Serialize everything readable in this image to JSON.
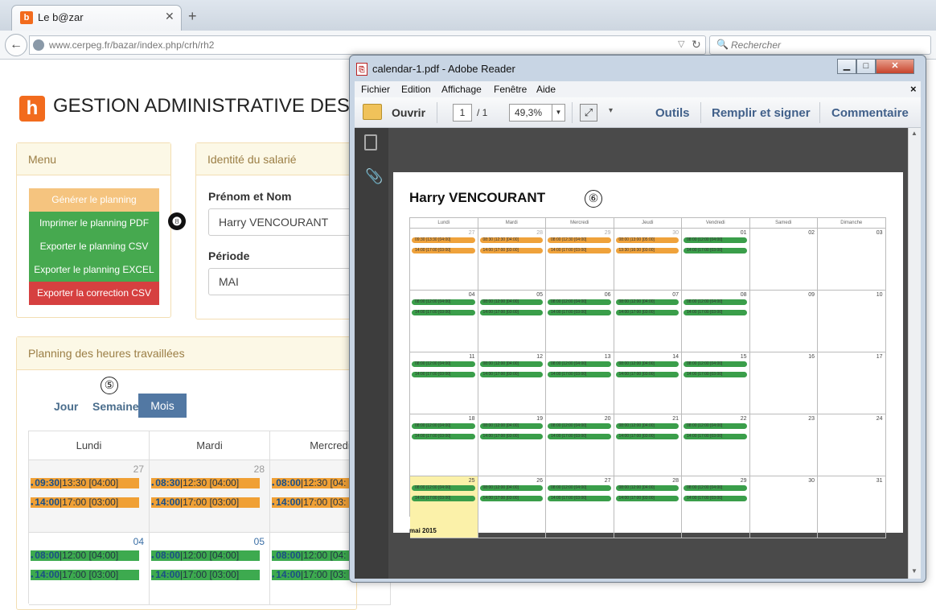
{
  "browser": {
    "tab_title": "Le b@zar",
    "favicon": "b",
    "new_tab": "+",
    "url": "www.cerpeg.fr/bazar/index.php/crh/rh2",
    "search_placeholder": "Rechercher"
  },
  "app": {
    "logo": "h",
    "title": "GESTION ADMINISTRATIVE DES"
  },
  "menu": {
    "title": "Menu",
    "buttons": [
      {
        "label": "Générer le planning",
        "color": "#f5c47f"
      },
      {
        "label": "Imprimer le planning PDF",
        "color": "#46a94f"
      },
      {
        "label": "Exporter le planning CSV",
        "color": "#46a94f"
      },
      {
        "label": "Exporter le planning EXCEL",
        "color": "#46a94f"
      },
      {
        "label": "Exporter la correction CSV",
        "color": "#d64040"
      }
    ]
  },
  "annotation_8": "❽",
  "identity": {
    "title": "Identité du salarié",
    "name_label": "Prénom et Nom",
    "name_value": "Harry VENCOURANT",
    "period_label": "Période",
    "period_value": "MAI"
  },
  "planning": {
    "title": "Planning des heures travaillées",
    "annotation_5": "⑤",
    "views": {
      "day": "Jour",
      "week": "Semaine",
      "month": "Mois"
    },
    "headers": [
      "Lundi",
      "Mardi",
      "Mercredi"
    ],
    "rows": [
      [
        {
          "day": "27",
          "events": [
            {
              "start": "09:30",
              "rest": "|13:30 [04:00]",
              "color": "orange"
            },
            {
              "start": "14:00",
              "rest": "|17:00 [03:00]",
              "color": "orange"
            }
          ]
        },
        {
          "day": "28",
          "events": [
            {
              "start": "08:30",
              "rest": "|12:30 [04:00]",
              "color": "orange"
            },
            {
              "start": "14:00",
              "rest": "|17:00 [03:00]",
              "color": "orange"
            }
          ]
        },
        {
          "day": "",
          "events": [
            {
              "start": "08:00",
              "rest": "|12:30 [04:",
              "color": "orange"
            },
            {
              "start": "14:00",
              "rest": "|17:00 [03:",
              "color": "orange"
            }
          ]
        }
      ],
      [
        {
          "day": "04",
          "events": [
            {
              "start": "08:00",
              "rest": "|12:00 [04:00]",
              "color": "green"
            },
            {
              "start": "14:00",
              "rest": "|17:00 [03:00]",
              "color": "green"
            }
          ]
        },
        {
          "day": "05",
          "events": [
            {
              "start": "08:00",
              "rest": "|12:00 [04:00]",
              "color": "green"
            },
            {
              "start": "14:00",
              "rest": "|17:00 [03:00]",
              "color": "green"
            }
          ]
        },
        {
          "day": "",
          "events": [
            {
              "start": "08:00",
              "rest": "|12:00 [04:",
              "color": "green"
            },
            {
              "start": "14:00",
              "rest": "|17:00 [03:",
              "color": "green"
            }
          ]
        }
      ]
    ]
  },
  "pdf_window": {
    "title": "calendar-1.pdf - Adobe Reader",
    "menu": [
      "Fichier",
      "Edition",
      "Affichage",
      "Fenêtre",
      "Aide"
    ],
    "close_doc": "×",
    "open_label": "Ouvrir",
    "page_current": "1",
    "page_total": "/ 1",
    "zoom": "49,3%",
    "tools": "Outils",
    "fill_sign": "Remplir et signer",
    "comment": "Commentaire",
    "document": {
      "name": "Harry VENCOURANT",
      "annotation_6": "⑥",
      "footer": "mai 2015",
      "day_headers": [
        "Lundi",
        "Mardi",
        "Mercredi",
        "Jeudi",
        "Vendredi",
        "Samedi",
        "Dimanche"
      ],
      "weeks": [
        {
          "days": [
            "27",
            "28",
            "29",
            "30",
            "01",
            "02",
            "03"
          ],
          "events": [
            [
              {
                "t": "09:30 |13:30 [04:00]",
                "c": "or"
              },
              {
                "t": "14:00 |17:00 [03:00]",
                "c": "or"
              }
            ],
            [
              {
                "t": "08:30 |12:30 [04:00]",
                "c": "or"
              },
              {
                "t": "14:00 |17:00 [03:00]",
                "c": "or"
              }
            ],
            [
              {
                "t": "08:00 |12:30 [04:00]",
                "c": "or"
              },
              {
                "t": "14:00 |17:00 [03:00]",
                "c": "or"
              }
            ],
            [
              {
                "t": "08:00 |13:00 [05:00]",
                "c": "or"
              },
              {
                "t": "13:30 |16:30 [03:00]",
                "c": "or"
              }
            ],
            [
              {
                "t": "08:00 |12:00 [04:00]",
                "c": "gr"
              },
              {
                "t": "14:00 |17:00 [03:00]",
                "c": "gr"
              }
            ],
            [],
            []
          ]
        },
        {
          "days": [
            "04",
            "05",
            "06",
            "07",
            "08",
            "09",
            "10"
          ],
          "events": [
            [
              {
                "t": "08:00 |12:00 [04:00]",
                "c": "gr"
              },
              {
                "t": "14:00 |17:00 [03:00]",
                "c": "gr"
              }
            ],
            [
              {
                "t": "08:00 |12:00 [04:00]",
                "c": "gr"
              },
              {
                "t": "14:00 |17:00 [03:00]",
                "c": "gr"
              }
            ],
            [
              {
                "t": "08:00 |12:00 [04:00]",
                "c": "gr"
              },
              {
                "t": "14:00 |17:00 [03:00]",
                "c": "gr"
              }
            ],
            [
              {
                "t": "08:00 |12:00 [04:00]",
                "c": "gr"
              },
              {
                "t": "14:00 |17:00 [03:00]",
                "c": "gr"
              }
            ],
            [
              {
                "t": "08:00 |12:00 [04:00]",
                "c": "gr"
              },
              {
                "t": "14:00 |17:00 [03:00]",
                "c": "gr"
              }
            ],
            [],
            []
          ]
        },
        {
          "days": [
            "11",
            "12",
            "13",
            "14",
            "15",
            "16",
            "17"
          ],
          "events": [
            [
              {
                "t": "08:00 |12:00 [04:00]",
                "c": "gr"
              },
              {
                "t": "14:00 |17:00 [03:00]",
                "c": "gr"
              }
            ],
            [
              {
                "t": "08:00 |12:00 [04:00]",
                "c": "gr"
              },
              {
                "t": "14:00 |17:00 [03:00]",
                "c": "gr"
              }
            ],
            [
              {
                "t": "08:00 |12:00 [04:00]",
                "c": "gr"
              },
              {
                "t": "14:00 |17:00 [03:00]",
                "c": "gr"
              }
            ],
            [
              {
                "t": "08:00 |12:00 [04:00]",
                "c": "gr"
              },
              {
                "t": "14:00 |17:00 [03:00]",
                "c": "gr"
              }
            ],
            [
              {
                "t": "08:00 |12:00 [04:00]",
                "c": "gr"
              },
              {
                "t": "14:00 |17:00 [03:00]",
                "c": "gr"
              }
            ],
            [],
            []
          ]
        },
        {
          "days": [
            "18",
            "19",
            "20",
            "21",
            "22",
            "23",
            "24"
          ],
          "events": [
            [
              {
                "t": "08:00 |12:00 [04:00]",
                "c": "gr"
              },
              {
                "t": "14:00 |17:00 [03:00]",
                "c": "gr"
              }
            ],
            [
              {
                "t": "08:00 |12:00 [04:00]",
                "c": "gr"
              },
              {
                "t": "14:00 |17:00 [03:00]",
                "c": "gr"
              }
            ],
            [
              {
                "t": "08:00 |12:00 [04:00]",
                "c": "gr"
              },
              {
                "t": "14:00 |17:00 [03:00]",
                "c": "gr"
              }
            ],
            [
              {
                "t": "08:00 |12:00 [04:00]",
                "c": "gr"
              },
              {
                "t": "14:00 |17:00 [03:00]",
                "c": "gr"
              }
            ],
            [
              {
                "t": "08:00 |12:00 [04:00]",
                "c": "gr"
              },
              {
                "t": "14:00 |17:00 [03:00]",
                "c": "gr"
              }
            ],
            [],
            []
          ]
        },
        {
          "days": [
            "25",
            "26",
            "27",
            "28",
            "29",
            "30",
            "31"
          ],
          "highlight": 0,
          "events": [
            [
              {
                "t": "08:00 |12:00 [04:00]",
                "c": "gr"
              },
              {
                "t": "14:00 |17:00 [03:00]",
                "c": "gr"
              }
            ],
            [
              {
                "t": "08:00 |12:00 [04:00]",
                "c": "gr"
              },
              {
                "t": "14:00 |17:00 [03:00]",
                "c": "gr"
              }
            ],
            [
              {
                "t": "08:00 |12:00 [04:00]",
                "c": "gr"
              },
              {
                "t": "14:00 |17:00 [03:00]",
                "c": "gr"
              }
            ],
            [
              {
                "t": "08:00 |12:00 [04:00]",
                "c": "gr"
              },
              {
                "t": "14:00 |17:00 [03:00]",
                "c": "gr"
              }
            ],
            [
              {
                "t": "08:00 |12:00 [04:00]",
                "c": "gr"
              },
              {
                "t": "14:00 |17:00 [03:00]",
                "c": "gr"
              }
            ],
            [],
            []
          ]
        }
      ]
    }
  },
  "colors": {
    "orange": "#f0a035",
    "green": "#3daa4f",
    "accent": "#f26b1d"
  }
}
